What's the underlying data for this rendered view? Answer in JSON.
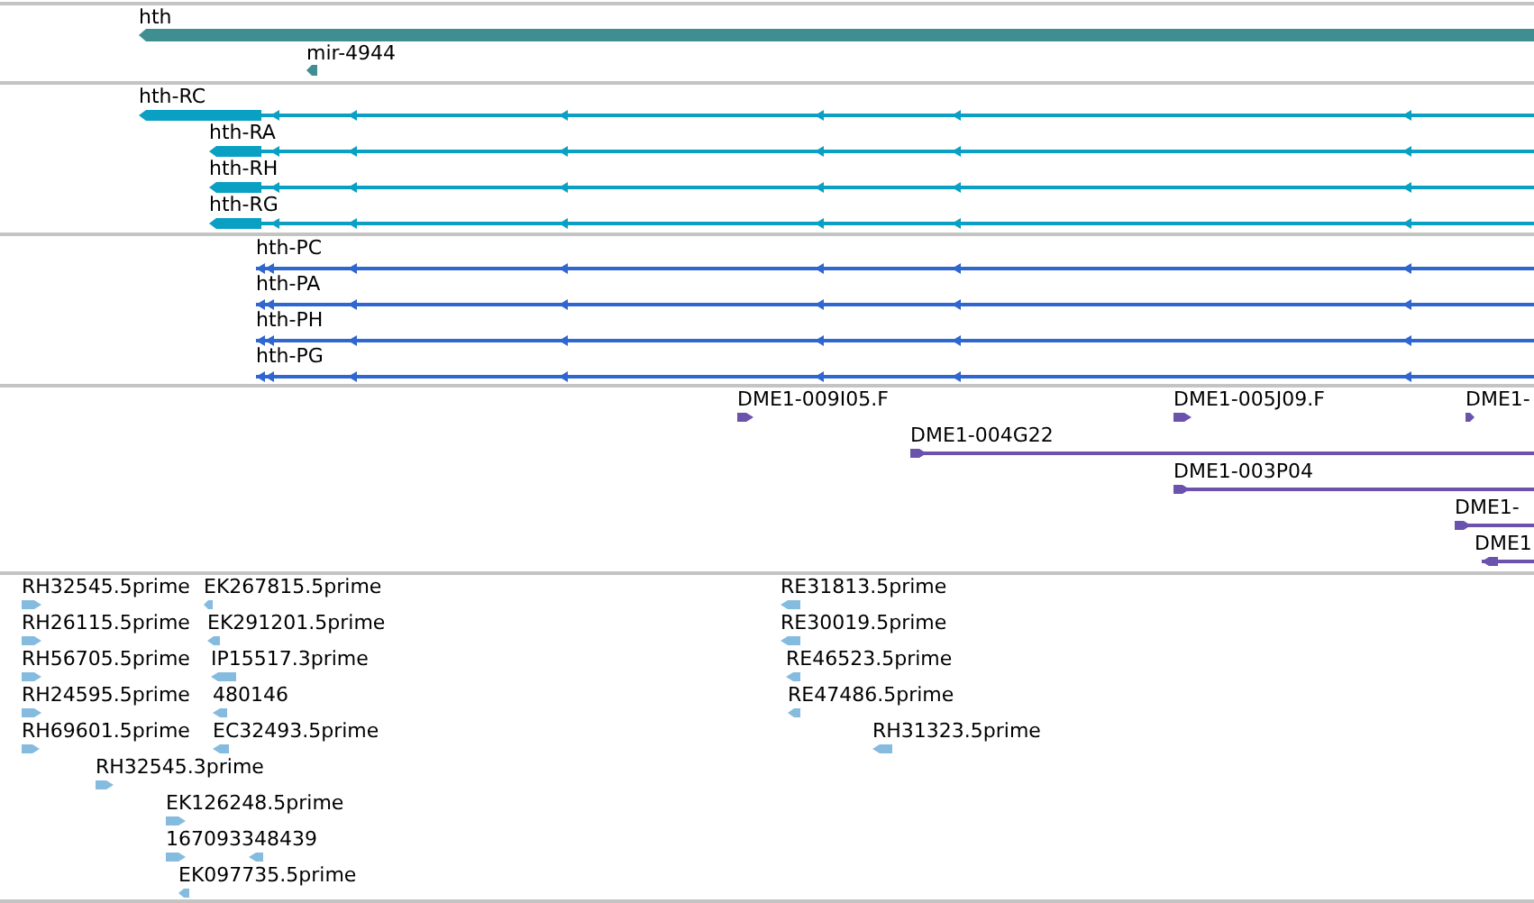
{
  "tracks": [
    {
      "kind": "gene",
      "features": [
        {
          "label": "hth",
          "reverse": true
        },
        {
          "label": "mir-4944",
          "reverse": true
        }
      ]
    },
    {
      "kind": "transcript",
      "features": [
        {
          "label": "hth-RC",
          "reverse": true
        },
        {
          "label": "hth-RA",
          "reverse": true
        },
        {
          "label": "hth-RH",
          "reverse": true
        },
        {
          "label": "hth-RG",
          "reverse": true
        }
      ]
    },
    {
      "kind": "protein",
      "features": [
        {
          "label": "hth-PC",
          "reverse": true
        },
        {
          "label": "hth-PA",
          "reverse": true
        },
        {
          "label": "hth-PH",
          "reverse": true
        },
        {
          "label": "hth-PG",
          "reverse": true
        }
      ]
    },
    {
      "kind": "clone",
      "features": [
        {
          "label": "DME1-009I05.F",
          "reverse": false
        },
        {
          "label": "DME1-005J09.F",
          "reverse": false
        },
        {
          "label": "DME1-",
          "reverse": false
        },
        {
          "label": "DME1-004G22",
          "reverse": false
        },
        {
          "label": "DME1-003P04",
          "reverse": false
        },
        {
          "label": "DME1-",
          "reverse": false
        },
        {
          "label": "DME1",
          "reverse": true
        }
      ]
    },
    {
      "kind": "est",
      "features": [
        {
          "label": "RH32545.5prime",
          "reverse": false
        },
        {
          "label": "EK267815.5prime",
          "reverse": true
        },
        {
          "label": "RH26115.5prime",
          "reverse": false
        },
        {
          "label": "EK291201.5prime",
          "reverse": true
        },
        {
          "label": "RH56705.5prime",
          "reverse": false
        },
        {
          "label": "IP15517.3prime",
          "reverse": true
        },
        {
          "label": "RH24595.5prime",
          "reverse": false
        },
        {
          "label": "480146",
          "reverse": true
        },
        {
          "label": "RH69601.5prime",
          "reverse": false
        },
        {
          "label": "EC32493.5prime",
          "reverse": true
        },
        {
          "label": "RH32545.3prime",
          "reverse": false
        },
        {
          "label": "EK126248.5prime",
          "reverse": false
        },
        {
          "label": "167093348439",
          "reverse": false
        },
        {
          "label": "EK097735.5prime",
          "reverse": true
        },
        {
          "label": "RE31813.5prime",
          "reverse": true
        },
        {
          "label": "RE30019.5prime",
          "reverse": true
        },
        {
          "label": "RE46523.5prime",
          "reverse": true
        },
        {
          "label": "RE47486.5prime",
          "reverse": true
        },
        {
          "label": "RH31323.5prime",
          "reverse": true
        }
      ]
    }
  ]
}
